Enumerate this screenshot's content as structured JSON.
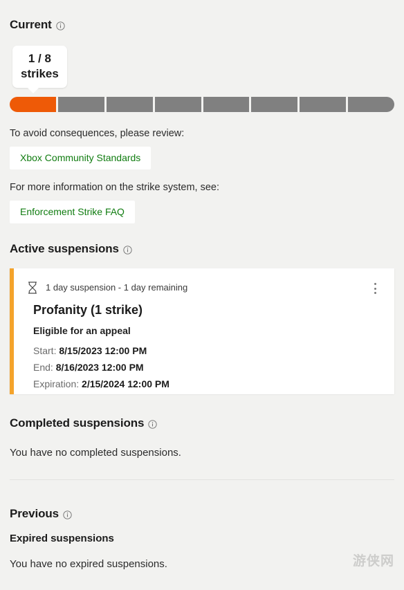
{
  "current": {
    "heading": "Current",
    "info_icon": "info-circle-icon",
    "tooltip": {
      "count_line": "1 / 8",
      "unit_line": "strikes"
    },
    "strikes_used": 1,
    "strikes_total": 8,
    "filled_color": "#ee5a07",
    "empty_color": "#808080",
    "prompt_standards": "To avoid consequences, please review:",
    "link_community_standards": "Xbox Community Standards",
    "prompt_faq": "For more information on the strike system, see:",
    "link_enforcement_faq": "Enforcement Strike FAQ",
    "link_color": "#107c10"
  },
  "active_suspensions": {
    "heading": "Active suspensions",
    "info_icon": "info-circle-icon",
    "card": {
      "accent_color": "#f4a32b",
      "status_icon": "hourglass-icon",
      "duration": "1 day suspension - 1 day remaining",
      "title": "Profanity (1 strike)",
      "appeal": "Eligible for an appeal",
      "rows": [
        {
          "label": "Start:",
          "value": "8/15/2023 12:00 PM"
        },
        {
          "label": "End:",
          "value": "8/16/2023 12:00 PM"
        },
        {
          "label": "Expiration:",
          "value": "2/15/2024 12:00 PM"
        }
      ],
      "menu_icon": "more-vertical-icon"
    }
  },
  "completed_suspensions": {
    "heading": "Completed suspensions",
    "info_icon": "info-circle-icon",
    "empty_text": "You have no completed suspensions."
  },
  "previous": {
    "heading": "Previous",
    "info_icon": "info-circle-icon",
    "expired_heading": "Expired suspensions",
    "empty_text": "You have no expired suspensions."
  },
  "watermark": "游侠网"
}
